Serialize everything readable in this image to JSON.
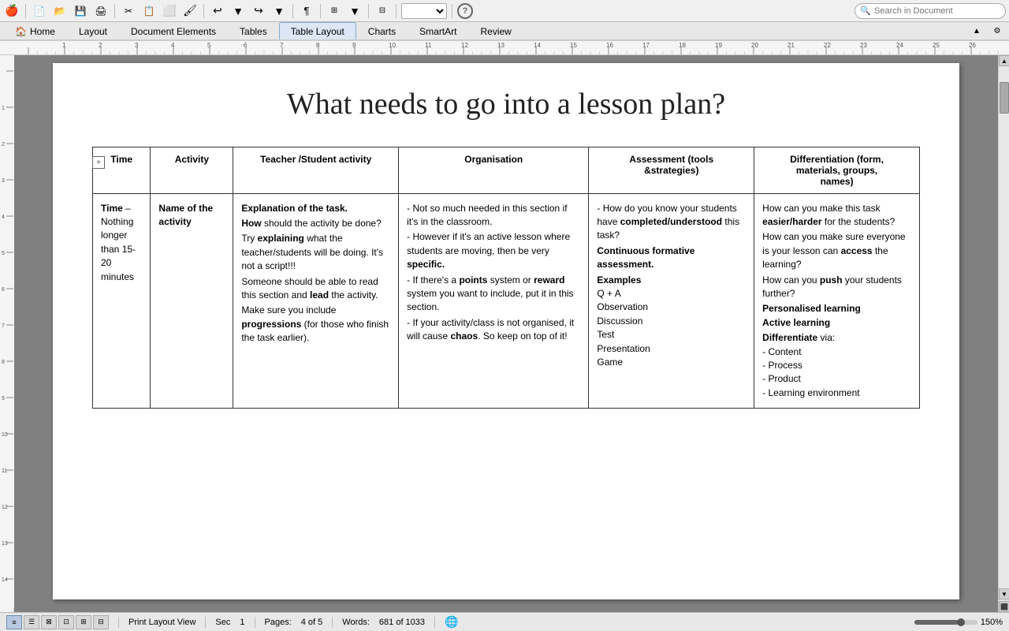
{
  "toolbar": {
    "zoom_value": "150%",
    "search_placeholder": "Search in Document"
  },
  "tabs": [
    {
      "id": "home",
      "label": "Home",
      "active": false,
      "has_icon": true
    },
    {
      "id": "layout",
      "label": "Layout",
      "active": false
    },
    {
      "id": "document_elements",
      "label": "Document Elements",
      "active": false
    },
    {
      "id": "tables",
      "label": "Tables",
      "active": false
    },
    {
      "id": "table_layout",
      "label": "Table Layout",
      "active": true
    },
    {
      "id": "charts",
      "label": "Charts",
      "active": false
    },
    {
      "id": "smartart",
      "label": "SmartArt",
      "active": false
    },
    {
      "id": "review",
      "label": "Review",
      "active": false
    }
  ],
  "document": {
    "title": "What needs to go into a lesson plan?",
    "table": {
      "headers": [
        "Time",
        "Activity",
        "Teacher /Student activity",
        "Organisation",
        "Assessment (tools &strategies)",
        "Differentiation (form, materials, groups, names)"
      ],
      "row": {
        "time": "Time – Nothing longer than 15-20 minutes",
        "activity": "Name of the activity",
        "teacher_parts": [
          {
            "text": "Explanation of the task.",
            "bold": true
          },
          {
            "text": "How should the activity be done?",
            "prefix_bold": "How"
          },
          {
            "text": "Try explaining what the teacher/students will be doing. It's not a script!!!",
            "prefix_bold": "explaining"
          },
          {
            "text": "Someone should be able to read this section and lead the activity.",
            "bold_word": "lead"
          },
          {
            "text": "Make sure you include progressions (for those who finish the task earlier).",
            "bold_word": "progressions"
          }
        ],
        "organisation_parts": [
          "- Not so much needed in this section if it's in the classroom.",
          "- However if it's an active lesson where students are moving, then be very specific.",
          "- If there's a points system or reward system you want to include, put it in this section.",
          "- If your activity/class is not organised, it will cause chaos. So keep on top of it!"
        ],
        "organisation_bold": [
          "points",
          "reward",
          "specific.",
          "chaos"
        ],
        "assessment_parts": [
          "- How do you know your students have completed/understood this task?",
          "Continuous formative assessment.",
          "Examples",
          "Q + A",
          "Observation",
          "Discussion",
          "Test",
          "Presentation",
          "Game"
        ],
        "assessment_bold": [
          "completed/understood",
          "Continuous formative assessment.",
          "Examples"
        ],
        "diff_parts": [
          "How can you make this task easier/harder for the students?",
          "How can you make sure everyone is your lesson can access the learning?",
          "How can you push your students further?",
          "Personalised learning",
          "Active learning",
          "Differentiate via:",
          "- Content",
          "- Process",
          "- Product",
          "- Learning environment"
        ],
        "diff_bold": [
          "easier/harder",
          "access",
          "push",
          "Personalised learning",
          "Active learning",
          "Differentiate"
        ]
      }
    }
  },
  "status_bar": {
    "view": "Print Layout View",
    "section": "Sec",
    "section_num": "1",
    "pages_label": "Pages:",
    "pages_value": "4 of 5",
    "words_label": "Words:",
    "words_value": "681 of 1033",
    "zoom": "150%"
  }
}
